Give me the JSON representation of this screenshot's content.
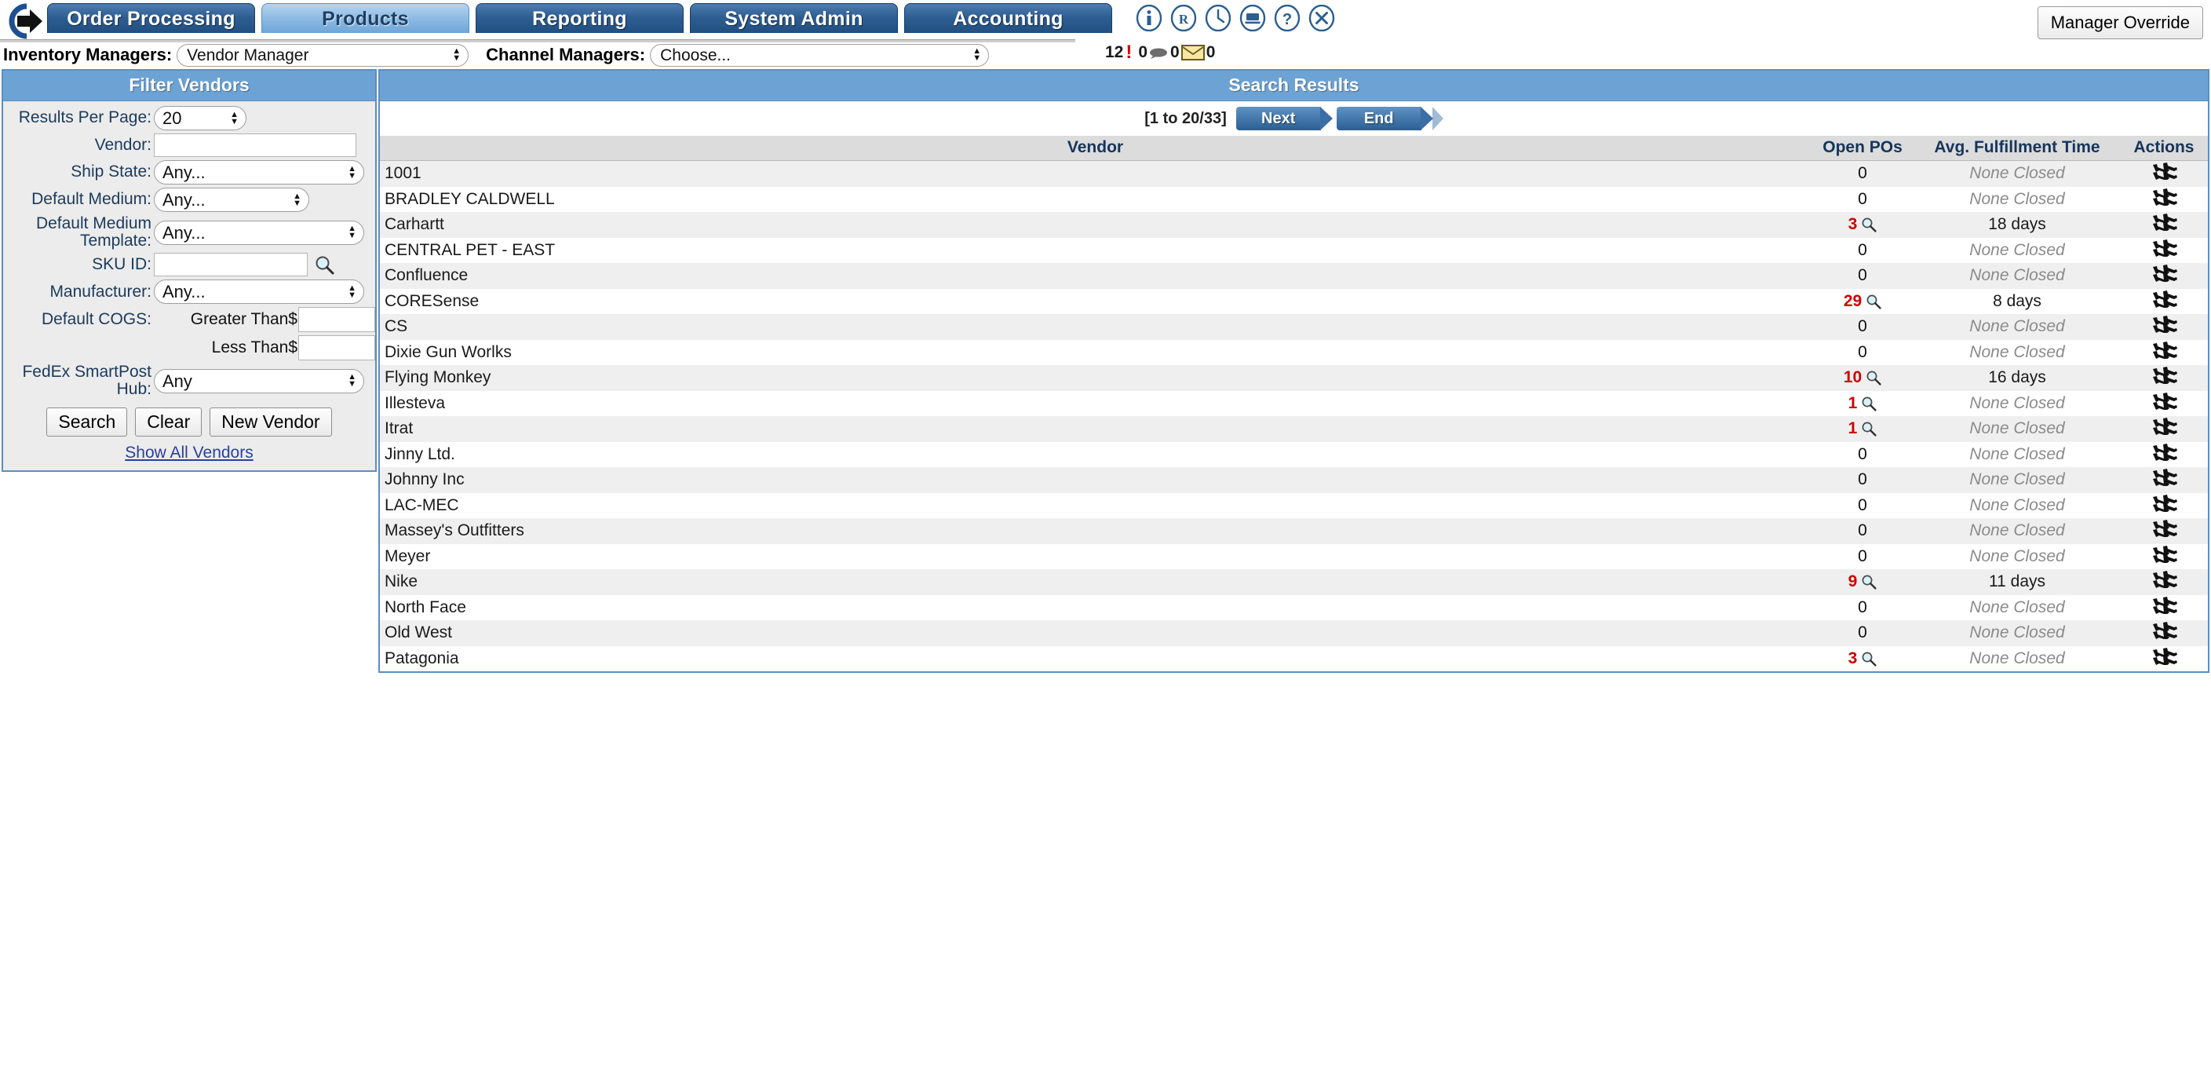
{
  "nav": {
    "logo_icon": "arrow-circle-logo",
    "tabs": [
      {
        "label": "Order Processing",
        "active": false
      },
      {
        "label": "Products",
        "active": true
      },
      {
        "label": "Reporting",
        "active": false
      },
      {
        "label": "System Admin",
        "active": false
      },
      {
        "label": "Accounting",
        "active": false
      }
    ],
    "icons": [
      {
        "name": "info-icon",
        "glyph": "i"
      },
      {
        "name": "registered-icon",
        "glyph": "R"
      },
      {
        "name": "clock-icon",
        "glyph": "clock"
      },
      {
        "name": "screen-icon",
        "glyph": "screen"
      },
      {
        "name": "help-icon",
        "glyph": "?"
      },
      {
        "name": "close-icon",
        "glyph": "x"
      }
    ],
    "manager_override_label": "Manager Override"
  },
  "managers": {
    "inventory_label": "Inventory Managers:",
    "inventory_value": "Vendor Manager",
    "inventory_options": [
      "Vendor Manager"
    ],
    "channel_label": "Channel Managers:",
    "channel_value": "Choose...",
    "channel_options": [
      "Choose..."
    ]
  },
  "counters": {
    "alerts": "12",
    "alert_icon": "red-exclamation-icon",
    "chats": "0",
    "chat_icon": "speech-bubble-icon",
    "mail": "0",
    "mail_icon": "envelope-icon",
    "mail_after": "0"
  },
  "filter": {
    "title": "Filter Vendors",
    "results_per_page_label": "Results Per Page:",
    "results_per_page_value": "20",
    "results_per_page_options": [
      "20"
    ],
    "vendor_label": "Vendor:",
    "vendor_value": "",
    "ship_state_label": "Ship State:",
    "ship_state_value": "Any...",
    "ship_state_options": [
      "Any..."
    ],
    "default_medium_label": "Default Medium:",
    "default_medium_value": "Any...",
    "default_medium_options": [
      "Any..."
    ],
    "default_medium_template_label": "Default Medium Template:",
    "default_medium_template_value": "Any...",
    "default_medium_template_options": [
      "Any..."
    ],
    "sku_id_label": "SKU ID:",
    "sku_id_value": "",
    "sku_search_icon": "magnifier-icon",
    "manufacturer_label": "Manufacturer:",
    "manufacturer_value": "Any...",
    "manufacturer_options": [
      "Any..."
    ],
    "default_cogs_label": "Default COGS:",
    "cogs_greater_label": "Greater Than$",
    "cogs_greater_value": "",
    "cogs_less_label": "Less Than$",
    "cogs_less_value": "",
    "fedex_label": "FedEx SmartPost Hub:",
    "fedex_value": "Any",
    "fedex_options": [
      "Any"
    ],
    "search_button": "Search",
    "clear_button": "Clear",
    "new_vendor_button": "New Vendor",
    "show_all_link": "Show All Vendors"
  },
  "results": {
    "title": "Search Results",
    "range": "[1 to 20/33]",
    "next_button": "Next",
    "end_button": "End",
    "columns": [
      "Vendor",
      "Open POs",
      "Avg. Fulfillment Time",
      "Actions"
    ],
    "none_closed_text": "None Closed",
    "magnifier_icon": "magnifier-icon",
    "actions_icon": "wrench-tools-icon",
    "rows": [
      {
        "vendor": "1001",
        "open_pos": "0",
        "avg": "None Closed",
        "avg_none": true,
        "has_mag": false
      },
      {
        "vendor": "BRADLEY CALDWELL",
        "open_pos": "0",
        "avg": "None Closed",
        "avg_none": true,
        "has_mag": false
      },
      {
        "vendor": "Carhartt",
        "open_pos": "3",
        "avg": "18 days",
        "avg_none": false,
        "has_mag": true
      },
      {
        "vendor": "CENTRAL PET - EAST",
        "open_pos": "0",
        "avg": "None Closed",
        "avg_none": true,
        "has_mag": false
      },
      {
        "vendor": "Confluence",
        "open_pos": "0",
        "avg": "None Closed",
        "avg_none": true,
        "has_mag": false
      },
      {
        "vendor": "CORESense",
        "open_pos": "29",
        "avg": "8 days",
        "avg_none": false,
        "has_mag": true
      },
      {
        "vendor": "CS",
        "open_pos": "0",
        "avg": "None Closed",
        "avg_none": true,
        "has_mag": false
      },
      {
        "vendor": "Dixie Gun Worlks",
        "open_pos": "0",
        "avg": "None Closed",
        "avg_none": true,
        "has_mag": false
      },
      {
        "vendor": "Flying Monkey",
        "open_pos": "10",
        "avg": "16 days",
        "avg_none": false,
        "has_mag": true
      },
      {
        "vendor": "Illesteva",
        "open_pos": "1",
        "avg": "None Closed",
        "avg_none": true,
        "has_mag": true
      },
      {
        "vendor": "Itrat",
        "open_pos": "1",
        "avg": "None Closed",
        "avg_none": true,
        "has_mag": true
      },
      {
        "vendor": "Jinny Ltd.",
        "open_pos": "0",
        "avg": "None Closed",
        "avg_none": true,
        "has_mag": false
      },
      {
        "vendor": "Johnny Inc",
        "open_pos": "0",
        "avg": "None Closed",
        "avg_none": true,
        "has_mag": false
      },
      {
        "vendor": "LAC-MEC",
        "open_pos": "0",
        "avg": "None Closed",
        "avg_none": true,
        "has_mag": false
      },
      {
        "vendor": "Massey's Outfitters",
        "open_pos": "0",
        "avg": "None Closed",
        "avg_none": true,
        "has_mag": false
      },
      {
        "vendor": "Meyer",
        "open_pos": "0",
        "avg": "None Closed",
        "avg_none": true,
        "has_mag": false
      },
      {
        "vendor": "Nike",
        "open_pos": "9",
        "avg": "11 days",
        "avg_none": false,
        "has_mag": true
      },
      {
        "vendor": "North Face",
        "open_pos": "0",
        "avg": "None Closed",
        "avg_none": true,
        "has_mag": false
      },
      {
        "vendor": "Old West",
        "open_pos": "0",
        "avg": "None Closed",
        "avg_none": true,
        "has_mag": false
      },
      {
        "vendor": "Patagonia",
        "open_pos": "3",
        "avg": "None Closed",
        "avg_none": true,
        "has_mag": true
      }
    ]
  },
  "colors": {
    "nav_blue": "#2e5e92",
    "active_tab": "#8dbbe3",
    "panel_header": "#6da3d4",
    "panel_border": "#5a8fc0",
    "alert_red": "#d00000",
    "link_blue": "#2a3fa0"
  }
}
